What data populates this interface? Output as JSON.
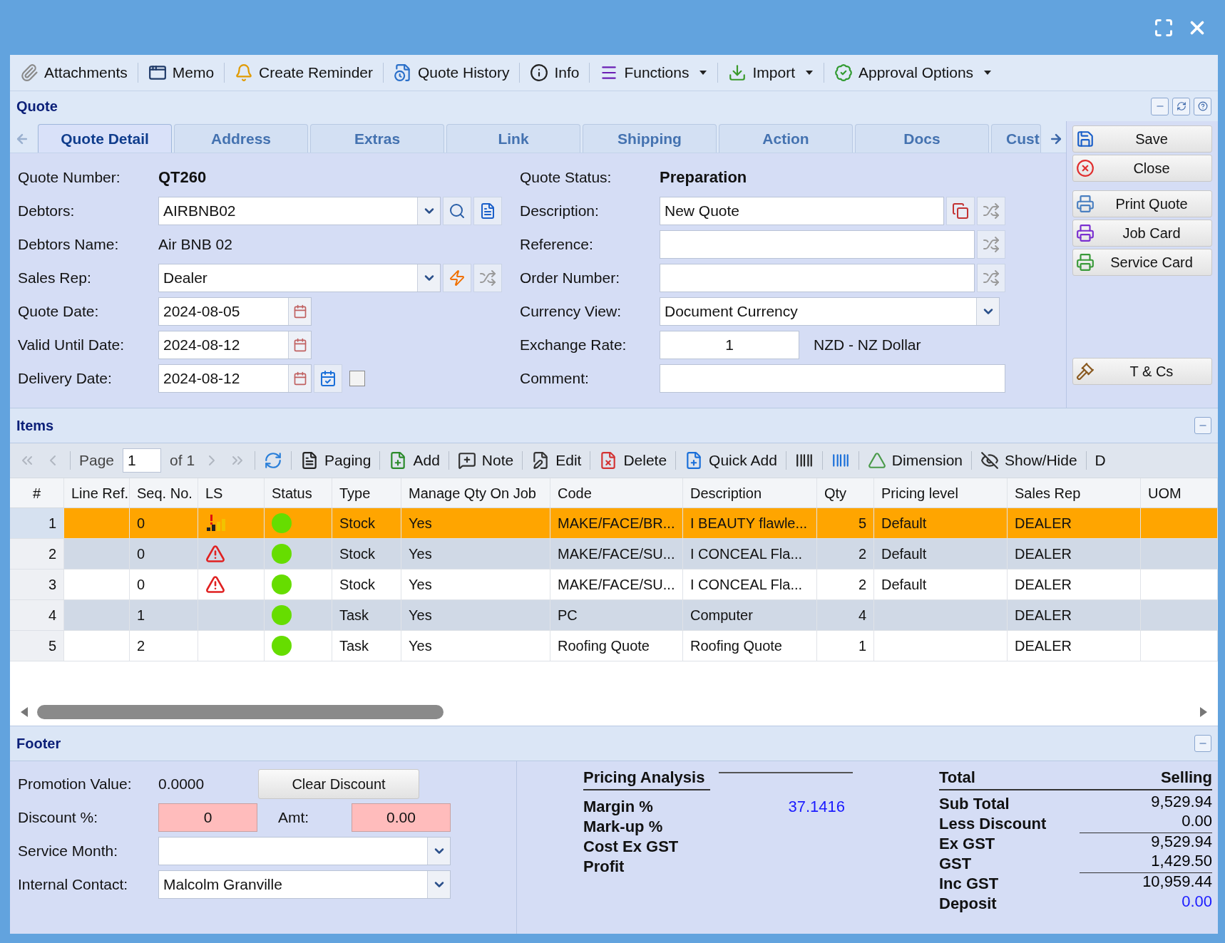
{
  "toolbar": [
    {
      "label": "Attachments",
      "dropdown": false
    },
    {
      "label": "Memo",
      "dropdown": false
    },
    {
      "label": "Create Reminder",
      "dropdown": false
    },
    {
      "label": "Quote History",
      "dropdown": false
    },
    {
      "label": "Info",
      "dropdown": false
    },
    {
      "label": "Functions",
      "dropdown": true
    },
    {
      "label": "Import",
      "dropdown": true
    },
    {
      "label": "Approval Options",
      "dropdown": true
    }
  ],
  "quote_panel": {
    "title": "Quote"
  },
  "tabs": [
    {
      "label": "Quote Detail",
      "selected": true
    },
    {
      "label": "Address",
      "selected": false
    },
    {
      "label": "Extras",
      "selected": false
    },
    {
      "label": "Link",
      "selected": false
    },
    {
      "label": "Shipping",
      "selected": false
    },
    {
      "label": "Action",
      "selected": false
    },
    {
      "label": "Docs",
      "selected": false
    },
    {
      "label": "Cust",
      "selected": false
    }
  ],
  "left_fields": [
    {
      "label": "Quote Number:",
      "kind": "bold",
      "value": "QT260"
    },
    {
      "label": "Debtors:",
      "kind": "combo",
      "value": "AIRBNB02"
    },
    {
      "label": "Debtors Name:",
      "kind": "text",
      "value": "Air BNB 02"
    },
    {
      "label": "Sales Rep:",
      "kind": "combo",
      "value": "Dealer"
    },
    {
      "label": "Quote Date:",
      "kind": "date",
      "value": "2024-08-05"
    },
    {
      "label": "Valid Until Date:",
      "kind": "date",
      "value": "2024-08-12"
    },
    {
      "label": "Delivery Date:",
      "kind": "date",
      "value": "2024-08-12",
      "checked": false
    }
  ],
  "right_fields": [
    {
      "label": "Quote Status:",
      "kind": "bold",
      "value": "Preparation"
    },
    {
      "label": "Description:",
      "kind": "input",
      "value": "New Quote"
    },
    {
      "label": "Reference:",
      "kind": "input"
    },
    {
      "label": "Order Number:",
      "kind": "input"
    },
    {
      "label": "Currency View:",
      "kind": "combo",
      "value": "Document Currency"
    },
    {
      "label": "Exchange Rate:",
      "kind": "rate",
      "value": "1",
      "note": "NZD - NZ Dollar"
    },
    {
      "label": "Comment:",
      "kind": "input"
    }
  ],
  "side_button_groups": [
    [
      {
        "label": "Save"
      },
      {
        "label": "Close"
      }
    ],
    [
      {
        "label": "Print Quote",
        "color": "#4a7fc0"
      },
      {
        "label": "Job Card",
        "color": "#7a2fd0"
      },
      {
        "label": "Service Card",
        "color": "#3a9a3a"
      }
    ],
    [
      {
        "label": "T & Cs"
      }
    ]
  ],
  "items": {
    "title": "Items",
    "pager": {
      "label": "Page",
      "page": "1",
      "of": "of 1"
    },
    "tools": [
      {
        "kind": "button",
        "label": "Paging"
      },
      {
        "kind": "button",
        "label": "Add"
      },
      {
        "kind": "button",
        "label": "Note"
      },
      {
        "kind": "button",
        "label": "Edit"
      },
      {
        "kind": "button",
        "label": "Delete"
      },
      {
        "kind": "button",
        "label": "Quick Add"
      },
      {
        "kind": "icon"
      },
      {
        "kind": "icon"
      },
      {
        "kind": "button",
        "label": "Dimension"
      },
      {
        "kind": "button",
        "label": "Show/Hide"
      },
      {
        "kind": "text",
        "label": "D"
      }
    ],
    "columns": [
      "#",
      "Line Ref.",
      "Seq. No.",
      "LS",
      "Status",
      "Type",
      "Manage Qty On Job",
      "Code",
      "Description",
      "Qty",
      "Pricing level",
      "Sales Rep",
      "UOM"
    ],
    "rows": [
      {
        "num": "1",
        "seq": "0",
        "kind": "low-stock",
        "type": "Stock",
        "manage": "Yes",
        "code": "MAKE/FACE/BR...",
        "description": "I BEAUTY flawle...",
        "qty": "5",
        "pricing": "Default",
        "rep": "DEALER",
        "selected": true
      },
      {
        "num": "2",
        "seq": "0",
        "kind": "warning",
        "type": "Stock",
        "manage": "Yes",
        "code": "MAKE/FACE/SU...",
        "description": "I CONCEAL Fla...",
        "qty": "2",
        "pricing": "Default",
        "rep": "DEALER",
        "selected": false
      },
      {
        "num": "3",
        "seq": "0",
        "kind": "warning",
        "type": "Stock",
        "manage": "Yes",
        "code": "MAKE/FACE/SU...",
        "description": "I CONCEAL Fla...",
        "qty": "2",
        "pricing": "Default",
        "rep": "DEALER",
        "selected": false
      },
      {
        "num": "4",
        "seq": "1",
        "kind": "task",
        "type": "Task",
        "manage": "Yes",
        "code": "PC",
        "description": "Computer",
        "qty": "4",
        "rep": "DEALER",
        "selected": false
      },
      {
        "num": "5",
        "seq": "2",
        "kind": "task",
        "type": "Task",
        "manage": "Yes",
        "code": "Roofing Quote",
        "description": "Roofing Quote",
        "qty": "1",
        "rep": "DEALER",
        "selected": false
      }
    ]
  },
  "footer": {
    "title": "Footer",
    "promotion": {
      "label": "Promotion Value:",
      "value": "0.0000"
    },
    "clear_button": "Clear Discount",
    "discount": {
      "label": "Discount %:",
      "value": "0"
    },
    "amount": {
      "label": "Amt:",
      "value": "0.00"
    },
    "service_month": {
      "label": "Service Month:"
    },
    "internal_contact": {
      "label": "Internal Contact:",
      "value": "Malcolm Granville"
    },
    "pricing": {
      "title": "Pricing Analysis",
      "rows": [
        {
          "label": "Margin %",
          "value": "37.1416",
          "color": "#1a1aff"
        },
        {
          "label": "Mark-up %"
        },
        {
          "label": "Cost Ex GST"
        },
        {
          "label": "Profit"
        }
      ]
    },
    "totals": {
      "title": "Total",
      "column": "Selling",
      "rows": [
        {
          "label": "Sub Total",
          "value": "9,529.94",
          "color": "#000000",
          "rule": false
        },
        {
          "label": "Less Discount",
          "value": "0.00",
          "color": "#000000",
          "rule": true
        },
        {
          "label": "Ex GST",
          "value": "9,529.94",
          "color": "#000000",
          "rule": false
        },
        {
          "label": "GST",
          "value": "1,429.50",
          "color": "#000000",
          "rule": true
        },
        {
          "label": "Inc GST",
          "value": "10,959.44",
          "color": "#000000",
          "rule": false
        },
        {
          "label": "Deposit",
          "value": "0.00",
          "color": "#1a1aff",
          "rule": false
        }
      ]
    }
  }
}
